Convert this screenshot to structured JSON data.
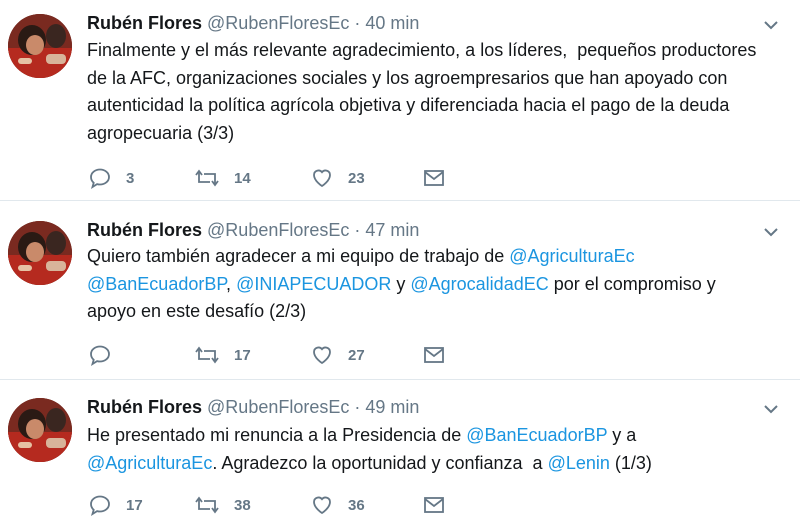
{
  "tweets": [
    {
      "author_name": "Rubén Flores",
      "author_handle": "@RubenFloresEc",
      "separator": "·",
      "time": "40 min",
      "avatar_icon": "user-avatar-photo",
      "text_segments": [
        {
          "text": "Finalmente y el más relevante agradecimiento, a los líderes,  pequeños productores de la AFC, organizaciones sociales y los agroempresarios que han apoyado con autenticidad la política agrícola objetiva y diferenciada hacia el pago de la deuda agropecuaria (3/3)",
          "type": "text"
        }
      ],
      "reply_count": "3",
      "retweet_count": "14",
      "like_count": "23"
    },
    {
      "author_name": "Rubén Flores",
      "author_handle": "@RubenFloresEc",
      "separator": "·",
      "time": "47 min",
      "avatar_icon": "user-avatar-photo",
      "text_segments": [
        {
          "text": "Quiero también agradecer a mi equipo de trabajo de ",
          "type": "text"
        },
        {
          "text": "@AgriculturaEc",
          "type": "mention"
        },
        {
          "text": " ",
          "type": "text"
        },
        {
          "text": "@BanEcuadorBP",
          "type": "mention"
        },
        {
          "text": ", ",
          "type": "text"
        },
        {
          "text": "@INIAPECUADOR",
          "type": "mention"
        },
        {
          "text": " y ",
          "type": "text"
        },
        {
          "text": "@AgrocalidadEC",
          "type": "mention"
        },
        {
          "text": " por el compromiso y apoyo en este desafío (2/3)",
          "type": "text"
        }
      ],
      "reply_count": "",
      "retweet_count": "17",
      "like_count": "27"
    },
    {
      "author_name": "Rubén Flores",
      "author_handle": "@RubenFloresEc",
      "separator": "·",
      "time": "49 min",
      "avatar_icon": "user-avatar-photo",
      "text_segments": [
        {
          "text": "He presentado mi renuncia a la Presidencia de ",
          "type": "text"
        },
        {
          "text": "@BanEcuadorBP",
          "type": "mention"
        },
        {
          "text": " y a ",
          "type": "text"
        },
        {
          "text": "@AgriculturaEc",
          "type": "mention"
        },
        {
          "text": ". Agradezco la oportunidad y confianza  a ",
          "type": "text"
        },
        {
          "text": "@Lenin",
          "type": "mention"
        },
        {
          "text": " (1/3)",
          "type": "text"
        }
      ],
      "reply_count": "17",
      "retweet_count": "38",
      "like_count": "36"
    }
  ],
  "icons": {
    "reply": "reply-icon",
    "retweet": "retweet-icon",
    "like": "heart-icon",
    "message": "envelope-icon",
    "menu": "chevron-down-icon"
  },
  "colors": {
    "text": "#14171a",
    "secondary": "#657786",
    "mention": "#1b95e0",
    "divider": "#e1e8ed"
  }
}
